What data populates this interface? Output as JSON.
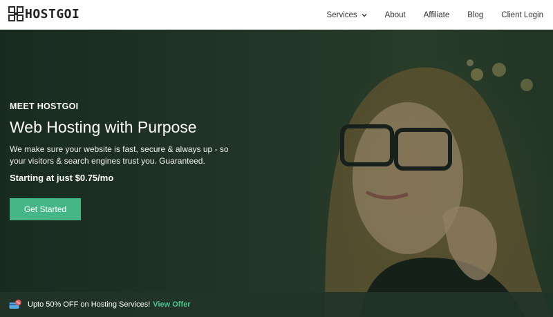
{
  "brand": {
    "name": "HOSTGOI",
    "logo_icon": "hostgoi-logo-icon"
  },
  "nav": {
    "items": [
      {
        "label": "Services",
        "has_dropdown": true
      },
      {
        "label": "About"
      },
      {
        "label": "Affiliate"
      },
      {
        "label": "Blog"
      },
      {
        "label": "Client Login"
      }
    ]
  },
  "hero": {
    "eyebrow": "MEET HOSTGOI",
    "title": "Web Hosting with Purpose",
    "description": "We make sure your website is fast, secure & always up - so your visitors & search engines trust you. Guaranteed.",
    "price_line": "Starting at just $0.75/mo",
    "cta_label": "Get Started"
  },
  "promo": {
    "icon": "discount-card-icon",
    "text": "Upto 50% OFF on Hosting Services!",
    "link_label": "View Offer"
  },
  "colors": {
    "accent": "#45b685",
    "link": "#4cc48d",
    "overlay": "#1f3a2a"
  }
}
